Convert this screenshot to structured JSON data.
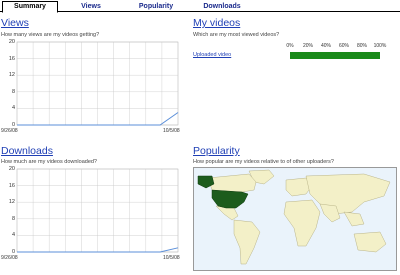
{
  "tabs": [
    {
      "label": "Summary",
      "active": true
    },
    {
      "label": "Views",
      "active": false
    },
    {
      "label": "Popularity",
      "active": false
    },
    {
      "label": "Downloads",
      "active": false
    }
  ],
  "views": {
    "title": "Views",
    "subtitle": "How many views are my videos getting?",
    "chart_data": {
      "type": "line",
      "x": [
        "9/26/08",
        "10/5/08"
      ],
      "y_ticks": [
        0,
        4,
        8,
        12,
        16,
        20
      ],
      "ylim": [
        0,
        20
      ],
      "series": [
        {
          "values": [
            0,
            0,
            0,
            0,
            0,
            0,
            0,
            0,
            0,
            3
          ]
        }
      ]
    },
    "x_start_label": "9/26/08",
    "x_end_label": "10/5/08"
  },
  "downloads": {
    "title": "Downloads",
    "subtitle": "How much are my videos downloaded?",
    "chart_data": {
      "type": "line",
      "x": [
        "9/26/08",
        "10/5/08"
      ],
      "y_ticks": [
        0,
        4,
        8,
        12,
        16,
        20
      ],
      "ylim": [
        0,
        20
      ],
      "series": [
        {
          "values": [
            0,
            0,
            0,
            0,
            0,
            0,
            0,
            0,
            0,
            1
          ]
        }
      ]
    },
    "x_start_label": "9/26/08",
    "x_end_label": "10/5/08"
  },
  "my_videos": {
    "title": "My videos",
    "subtitle": "Which are my most viewed videos?",
    "scale": [
      "0%",
      "20%",
      "40%",
      "60%",
      "80%",
      "100%"
    ],
    "items": [
      {
        "label": "Uploaded video",
        "percent": 100
      }
    ],
    "bar_color": "#1a8a1a"
  },
  "popularity": {
    "title": "Popularity",
    "subtitle": "How popular are my videos relative to of other uploaders?",
    "highlight_region": "United States",
    "highlight_color": "#1d5c1d",
    "land_color": "#f3f0c8"
  },
  "colors": {
    "link": "#1f3fb5",
    "line": "#5b8fd9",
    "grid": "#c8c8c8"
  }
}
